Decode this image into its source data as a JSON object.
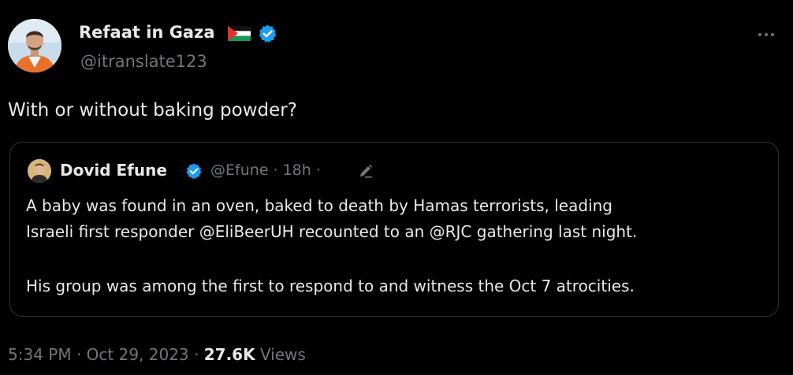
{
  "tweet": {
    "author_name": "Refaat in Gaza",
    "author_flag_icon": "palestine-flag-icon",
    "verified_icon": "verified-badge-icon",
    "handle": "@itranslate123",
    "more_icon": "more-options-icon",
    "text": "With or without baking powder?",
    "timestamp": "5:34 PM · Oct 29, 2023 ·",
    "views_count": "27.6K",
    "views_label": "Views"
  },
  "quote": {
    "author_name": "Dovid Efune",
    "handle_time": "@Efune · 18h ·",
    "edited_icon": "edit-pencil-icon",
    "lines": [
      "A baby was found in an oven, baked to death by Hamas terrorists, leading",
      "Israeli first responder @EliBeerUH recounted to an @RJC gathering last night.",
      "His group was among the first to respond to and witness the Oct 7 atrocities."
    ]
  },
  "colors": {
    "background": "#000000",
    "primary_text": "#e7e9ea",
    "secondary_text": "#71767b",
    "verified_blue": "#1d9bf0",
    "border": "#2f3336"
  }
}
